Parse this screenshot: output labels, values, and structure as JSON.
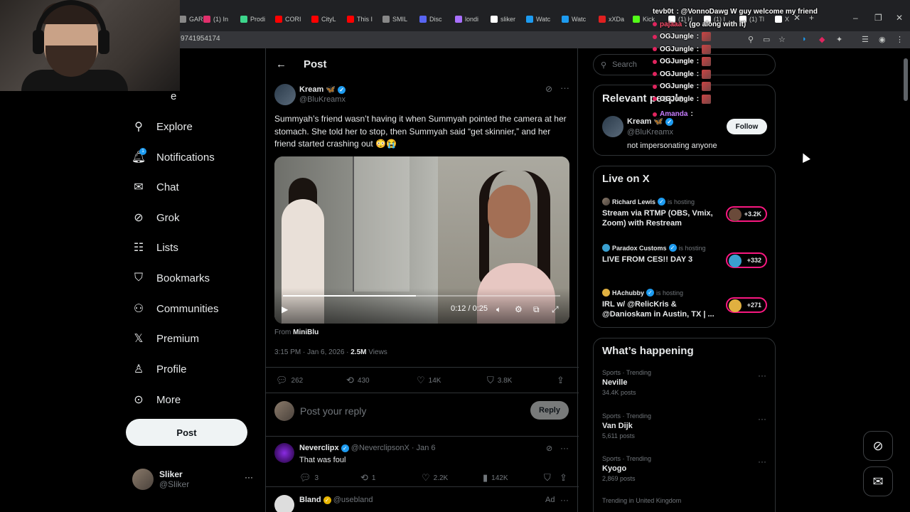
{
  "browser": {
    "tabs": [
      {
        "label": "GAR",
        "color": "#888888"
      },
      {
        "label": "(1) In",
        "color": "#e1306c"
      },
      {
        "label": "Prodi",
        "color": "#3dd68c"
      },
      {
        "label": "CORI",
        "color": "#ff0000"
      },
      {
        "label": "CityL",
        "color": "#ff0000"
      },
      {
        "label": "This I",
        "color": "#ff0000"
      },
      {
        "label": "SMIL",
        "color": "#888888"
      },
      {
        "label": "Disc",
        "color": "#5865f2"
      },
      {
        "label": "londi",
        "color": "#a970ff"
      },
      {
        "label": "sliker",
        "color": "#ffffff"
      },
      {
        "label": "Watc",
        "color": "#1d9bf0"
      },
      {
        "label": "Watc",
        "color": "#1d9bf0"
      },
      {
        "label": "xXDa",
        "color": "#e02020"
      },
      {
        "label": "Kick",
        "color": "#53fc18"
      },
      {
        "label": "(1) H",
        "color": "#ffffff"
      },
      {
        "label": "(1) I",
        "color": "#ffffff"
      },
      {
        "label": "(1) Tl",
        "color": "#ffffff"
      },
      {
        "label": "X",
        "color": "#ffffff"
      }
    ],
    "url": "97419541​74"
  },
  "chat": [
    {
      "user": "tevb0t",
      "text": ": @VonnoDawg W guy welcome my friend",
      "color": "#ffffff"
    },
    {
      "user": "pajaaa",
      "text": ": (go along with it)",
      "color": "#ff4f6d"
    },
    {
      "user": "OGJungle",
      "text": ":",
      "color": "#ffffff"
    },
    {
      "user": "OGJungle",
      "text": ":",
      "color": "#ffffff"
    },
    {
      "user": "OGJungle",
      "text": ":",
      "color": "#ffffff"
    },
    {
      "user": "OGJungle",
      "text": ":",
      "color": "#ffffff"
    },
    {
      "user": "OGJungle",
      "text": ":",
      "color": "#ffffff"
    },
    {
      "user": "OGJungle",
      "text": ":",
      "color": "#ffffff"
    },
    {
      "user": "Amanda",
      "text": ":",
      "color": "#c77dff"
    }
  ],
  "nav": {
    "home": "e",
    "explore": "Explore",
    "notifications": "Notifications",
    "notifications_badge": "1",
    "chat": "Chat",
    "grok": "Grok",
    "lists": "Lists",
    "bookmarks": "Bookmarks",
    "communities": "Communities",
    "premium": "Premium",
    "profile": "Profile",
    "more": "More",
    "post_button": "Post"
  },
  "account": {
    "name": "Sliker",
    "handle": "@Sliker",
    "more": "···"
  },
  "post": {
    "header": "Post",
    "author_name": "Kream 🦋",
    "author_handle": "@BluKreamx",
    "text": "Summyah’s friend wasn’t having it when Summyah pointed the camera at her stomach. She told her to stop, then Summyah said “get skinnier,” and her friend started crashing out 😳😭",
    "video_time": "0:12 / 0:25",
    "video_progress": 0.48,
    "from_label": "From",
    "from_source": "MiniBlu",
    "timestamp": "3:15 PM · Jan 6, 2026 · ",
    "views_count": "2.5M",
    "views_label": " Views",
    "replies": "262",
    "reposts": "430",
    "likes": "14K",
    "bookmarks": "3.8K",
    "reply_placeholder": "Post your reply",
    "reply_button": "Reply"
  },
  "replies": [
    {
      "name": "Neverclipx",
      "handle": "@NeverclipsonX · Jan 6",
      "text": "That was foul",
      "replies": "3",
      "reposts": "1",
      "likes": "2.2K",
      "views": "142K"
    },
    {
      "name": "Bland",
      "handle": "@usebland",
      "ad": "Ad"
    }
  ],
  "sidebar": {
    "search_placeholder": "Search",
    "relevant_title": "Relevant people",
    "relevant": {
      "name": "Kream 🦋",
      "handle": "@BluKreamx",
      "bio": "not impersonating anyone",
      "follow": "Follow"
    },
    "live_title": "Live on X",
    "live": [
      {
        "host": "Richard Lewis",
        "status": "is hosting",
        "title": "Stream via RTMP (OBS, Vmix, Zoom) with Restream",
        "count": "+3.2K"
      },
      {
        "host": "Paradox Customs",
        "status": "is hosting",
        "title": "LIVE FROM CES!! DAY 3",
        "count": "+332"
      },
      {
        "host": "HAchubby",
        "status": "is hosting",
        "title": "IRL w/ @RelicKris & @Danioskam in Austin, TX | ...",
        "count": "+271"
      }
    ],
    "happening_title": "What’s happening",
    "trends": [
      {
        "category": "Sports · Trending",
        "name": "Neville",
        "count": "34.4K posts"
      },
      {
        "category": "Sports · Trending",
        "name": "Van Dijk",
        "count": "5,611 posts"
      },
      {
        "category": "Sports · Trending",
        "name": "Kyogo",
        "count": "2,869 posts"
      },
      {
        "category": "Trending in United Kingdom",
        "name": "",
        "count": ""
      }
    ]
  },
  "colors": {
    "accent": "#1d9bf0",
    "live": "#f91880",
    "bg": "#000000"
  }
}
